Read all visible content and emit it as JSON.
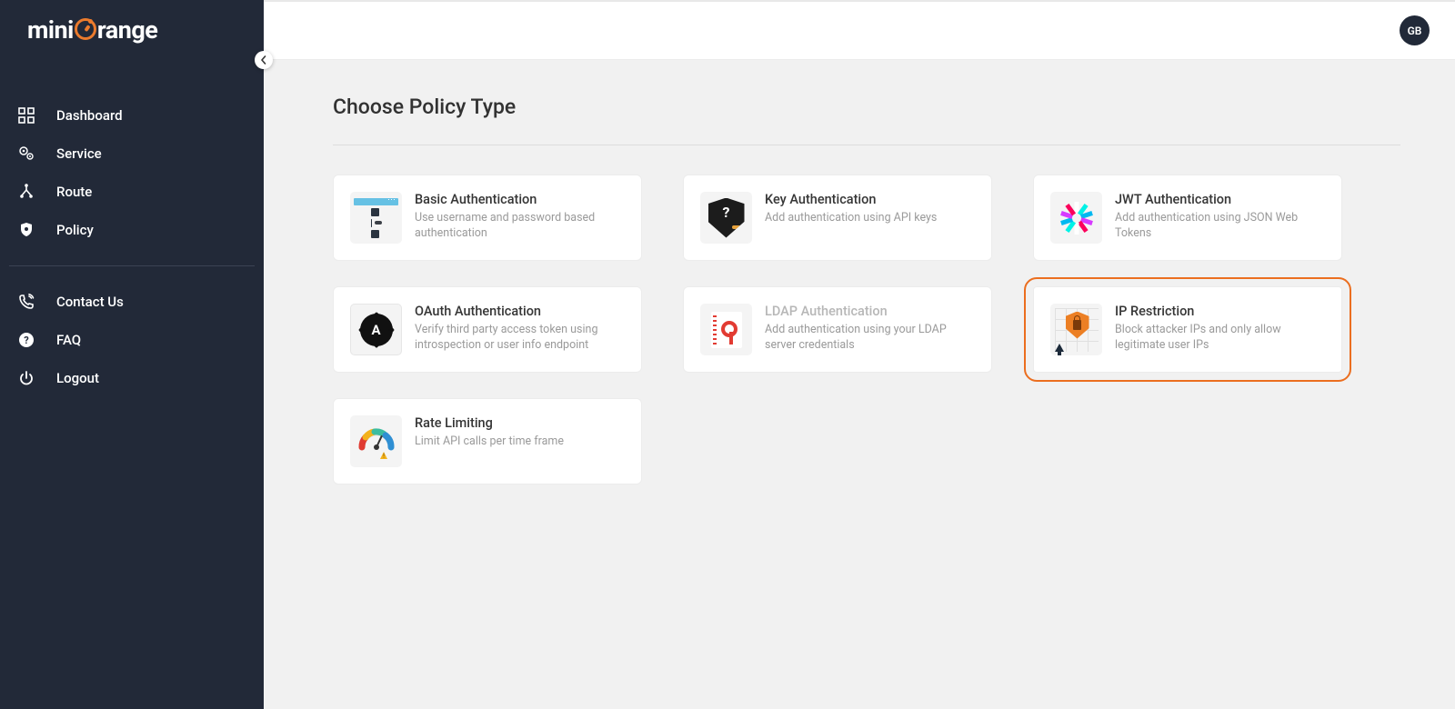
{
  "brand": {
    "pre": "mini",
    "post": "range"
  },
  "sidebar": {
    "items": [
      {
        "label": "Dashboard",
        "icon": "grid-icon"
      },
      {
        "label": "Service",
        "icon": "gears-icon"
      },
      {
        "label": "Route",
        "icon": "route-icon"
      },
      {
        "label": "Policy",
        "icon": "shield-icon"
      }
    ],
    "secondary": [
      {
        "label": "Contact Us",
        "icon": "phone-icon"
      },
      {
        "label": "FAQ",
        "icon": "question-icon"
      },
      {
        "label": "Logout",
        "icon": "power-icon"
      }
    ]
  },
  "user": {
    "initials": "GB"
  },
  "page": {
    "title": "Choose Policy Type"
  },
  "policies": {
    "basic": {
      "title": "Basic Authentication",
      "desc": "Use username and password based authentication"
    },
    "key": {
      "title": "Key Authentication",
      "desc": "Add authentication using API keys"
    },
    "jwt": {
      "title": "JWT Authentication",
      "desc": "Add authentication using JSON Web Tokens"
    },
    "oauth": {
      "title": "OAuth Authentication",
      "desc": "Verify third party access token using introspection or user info endpoint"
    },
    "ldap": {
      "title": "LDAP Authentication",
      "desc": "Add authentication using your LDAP server credentials"
    },
    "ip": {
      "title": "IP Restriction",
      "desc": "Block attacker IPs and only allow legitimate user IPs"
    },
    "rate": {
      "title": "Rate Limiting",
      "desc": "Limit API calls per time frame"
    }
  }
}
